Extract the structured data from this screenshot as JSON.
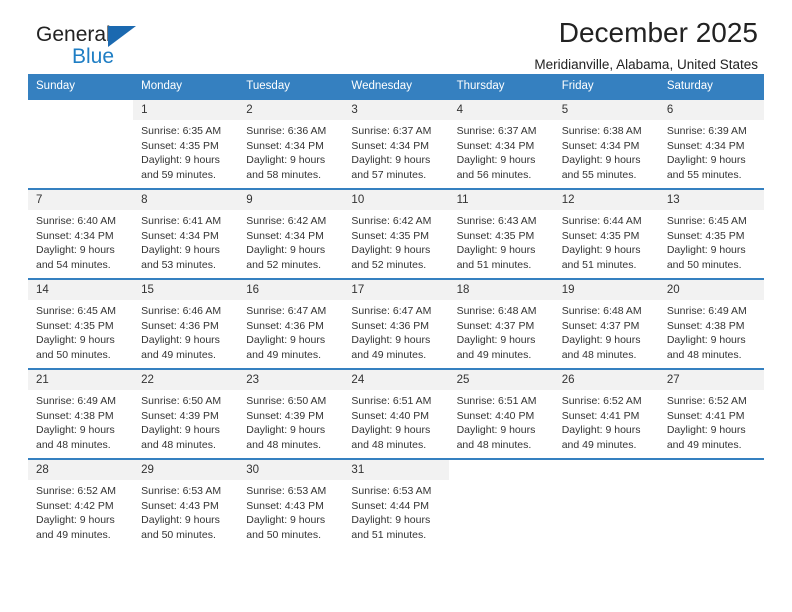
{
  "brand": {
    "name_top": "General",
    "name_bottom": "Blue",
    "triangle_color": "#1b69b0",
    "blue_text_color": "#1f7ec4"
  },
  "header": {
    "title": "December 2025",
    "location": "Meridianville, Alabama, United States",
    "header_bg_color": "#3580c0",
    "daynum_bg_color": "#f2f2f2"
  },
  "calendar": {
    "weekday_headers": [
      "Sunday",
      "Monday",
      "Tuesday",
      "Wednesday",
      "Thursday",
      "Friday",
      "Saturday"
    ],
    "weeks": [
      [
        {
          "day": "",
          "lines": []
        },
        {
          "day": "1",
          "lines": [
            "Sunrise: 6:35 AM",
            "Sunset: 4:35 PM",
            "Daylight: 9 hours",
            "and 59 minutes."
          ]
        },
        {
          "day": "2",
          "lines": [
            "Sunrise: 6:36 AM",
            "Sunset: 4:34 PM",
            "Daylight: 9 hours",
            "and 58 minutes."
          ]
        },
        {
          "day": "3",
          "lines": [
            "Sunrise: 6:37 AM",
            "Sunset: 4:34 PM",
            "Daylight: 9 hours",
            "and 57 minutes."
          ]
        },
        {
          "day": "4",
          "lines": [
            "Sunrise: 6:37 AM",
            "Sunset: 4:34 PM",
            "Daylight: 9 hours",
            "and 56 minutes."
          ]
        },
        {
          "day": "5",
          "lines": [
            "Sunrise: 6:38 AM",
            "Sunset: 4:34 PM",
            "Daylight: 9 hours",
            "and 55 minutes."
          ]
        },
        {
          "day": "6",
          "lines": [
            "Sunrise: 6:39 AM",
            "Sunset: 4:34 PM",
            "Daylight: 9 hours",
            "and 55 minutes."
          ]
        }
      ],
      [
        {
          "day": "7",
          "lines": [
            "Sunrise: 6:40 AM",
            "Sunset: 4:34 PM",
            "Daylight: 9 hours",
            "and 54 minutes."
          ]
        },
        {
          "day": "8",
          "lines": [
            "Sunrise: 6:41 AM",
            "Sunset: 4:34 PM",
            "Daylight: 9 hours",
            "and 53 minutes."
          ]
        },
        {
          "day": "9",
          "lines": [
            "Sunrise: 6:42 AM",
            "Sunset: 4:34 PM",
            "Daylight: 9 hours",
            "and 52 minutes."
          ]
        },
        {
          "day": "10",
          "lines": [
            "Sunrise: 6:42 AM",
            "Sunset: 4:35 PM",
            "Daylight: 9 hours",
            "and 52 minutes."
          ]
        },
        {
          "day": "11",
          "lines": [
            "Sunrise: 6:43 AM",
            "Sunset: 4:35 PM",
            "Daylight: 9 hours",
            "and 51 minutes."
          ]
        },
        {
          "day": "12",
          "lines": [
            "Sunrise: 6:44 AM",
            "Sunset: 4:35 PM",
            "Daylight: 9 hours",
            "and 51 minutes."
          ]
        },
        {
          "day": "13",
          "lines": [
            "Sunrise: 6:45 AM",
            "Sunset: 4:35 PM",
            "Daylight: 9 hours",
            "and 50 minutes."
          ]
        }
      ],
      [
        {
          "day": "14",
          "lines": [
            "Sunrise: 6:45 AM",
            "Sunset: 4:35 PM",
            "Daylight: 9 hours",
            "and 50 minutes."
          ]
        },
        {
          "day": "15",
          "lines": [
            "Sunrise: 6:46 AM",
            "Sunset: 4:36 PM",
            "Daylight: 9 hours",
            "and 49 minutes."
          ]
        },
        {
          "day": "16",
          "lines": [
            "Sunrise: 6:47 AM",
            "Sunset: 4:36 PM",
            "Daylight: 9 hours",
            "and 49 minutes."
          ]
        },
        {
          "day": "17",
          "lines": [
            "Sunrise: 6:47 AM",
            "Sunset: 4:36 PM",
            "Daylight: 9 hours",
            "and 49 minutes."
          ]
        },
        {
          "day": "18",
          "lines": [
            "Sunrise: 6:48 AM",
            "Sunset: 4:37 PM",
            "Daylight: 9 hours",
            "and 49 minutes."
          ]
        },
        {
          "day": "19",
          "lines": [
            "Sunrise: 6:48 AM",
            "Sunset: 4:37 PM",
            "Daylight: 9 hours",
            "and 48 minutes."
          ]
        },
        {
          "day": "20",
          "lines": [
            "Sunrise: 6:49 AM",
            "Sunset: 4:38 PM",
            "Daylight: 9 hours",
            "and 48 minutes."
          ]
        }
      ],
      [
        {
          "day": "21",
          "lines": [
            "Sunrise: 6:49 AM",
            "Sunset: 4:38 PM",
            "Daylight: 9 hours",
            "and 48 minutes."
          ]
        },
        {
          "day": "22",
          "lines": [
            "Sunrise: 6:50 AM",
            "Sunset: 4:39 PM",
            "Daylight: 9 hours",
            "and 48 minutes."
          ]
        },
        {
          "day": "23",
          "lines": [
            "Sunrise: 6:50 AM",
            "Sunset: 4:39 PM",
            "Daylight: 9 hours",
            "and 48 minutes."
          ]
        },
        {
          "day": "24",
          "lines": [
            "Sunrise: 6:51 AM",
            "Sunset: 4:40 PM",
            "Daylight: 9 hours",
            "and 48 minutes."
          ]
        },
        {
          "day": "25",
          "lines": [
            "Sunrise: 6:51 AM",
            "Sunset: 4:40 PM",
            "Daylight: 9 hours",
            "and 48 minutes."
          ]
        },
        {
          "day": "26",
          "lines": [
            "Sunrise: 6:52 AM",
            "Sunset: 4:41 PM",
            "Daylight: 9 hours",
            "and 49 minutes."
          ]
        },
        {
          "day": "27",
          "lines": [
            "Sunrise: 6:52 AM",
            "Sunset: 4:41 PM",
            "Daylight: 9 hours",
            "and 49 minutes."
          ]
        }
      ],
      [
        {
          "day": "28",
          "lines": [
            "Sunrise: 6:52 AM",
            "Sunset: 4:42 PM",
            "Daylight: 9 hours",
            "and 49 minutes."
          ]
        },
        {
          "day": "29",
          "lines": [
            "Sunrise: 6:53 AM",
            "Sunset: 4:43 PM",
            "Daylight: 9 hours",
            "and 50 minutes."
          ]
        },
        {
          "day": "30",
          "lines": [
            "Sunrise: 6:53 AM",
            "Sunset: 4:43 PM",
            "Daylight: 9 hours",
            "and 50 minutes."
          ]
        },
        {
          "day": "31",
          "lines": [
            "Sunrise: 6:53 AM",
            "Sunset: 4:44 PM",
            "Daylight: 9 hours",
            "and 51 minutes."
          ]
        },
        {
          "day": "",
          "lines": []
        },
        {
          "day": "",
          "lines": []
        },
        {
          "day": "",
          "lines": []
        }
      ]
    ]
  }
}
